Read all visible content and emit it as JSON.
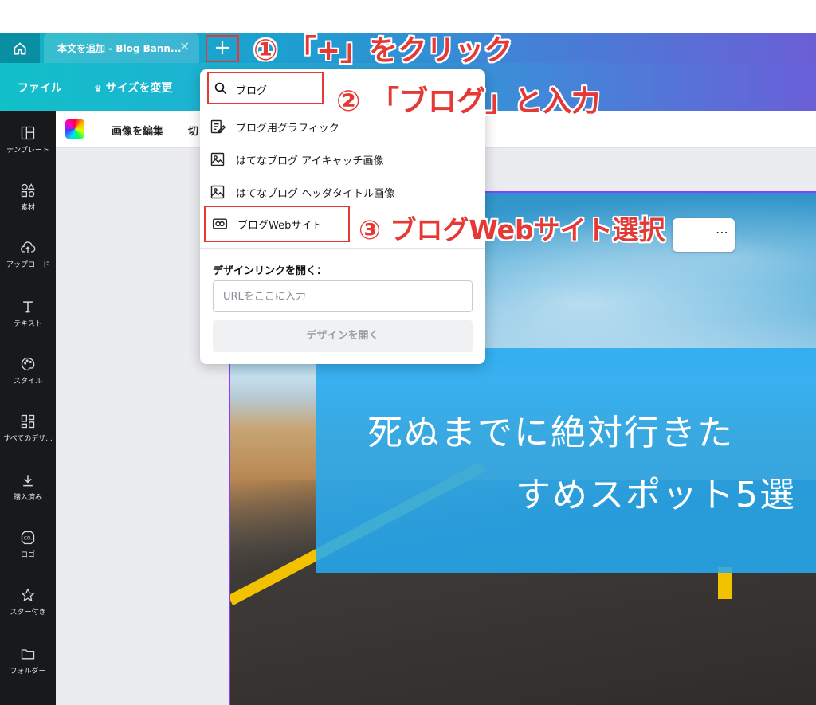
{
  "tabbar": {
    "home_icon": "home-icon",
    "doc_tab_title": "本文を追加 - Blog Bann...",
    "doc_tab_close": "×",
    "new_tab_plus": "+"
  },
  "menubar": {
    "file": "ファイル",
    "resize": "サイズを変更",
    "resize_icon": "crown-icon"
  },
  "sidebar": {
    "items": [
      {
        "label": "テンプレート",
        "icon": "template-icon"
      },
      {
        "label": "素材",
        "icon": "elements-icon"
      },
      {
        "label": "アップロード",
        "icon": "upload-icon"
      },
      {
        "label": "テキスト",
        "icon": "text-icon"
      },
      {
        "label": "スタイル",
        "icon": "palette-icon"
      },
      {
        "label": "すべてのデザ...",
        "icon": "grid-icon"
      },
      {
        "label": "購入済み",
        "icon": "download-icon"
      },
      {
        "label": "ロゴ",
        "icon": "logo-icon"
      },
      {
        "label": "スター付き",
        "icon": "star-icon"
      },
      {
        "label": "フォルダー",
        "icon": "folder-icon"
      }
    ]
  },
  "editbar": {
    "edit_image": "画像を編集",
    "crop_partial": "切"
  },
  "dropdown": {
    "search_value": "ブログ",
    "results": [
      {
        "label": "ブログ用グラフィック",
        "icon": "edit-doc-icon"
      },
      {
        "label": "はてなブログ アイキャッチ画像",
        "icon": "image-icon"
      },
      {
        "label": "はてなブログ ヘッダタイトル画像",
        "icon": "image-icon"
      },
      {
        "label": "ブログWebサイト",
        "icon": "website-icon"
      }
    ],
    "open_link_heading": "デザインリンクを開く：",
    "url_placeholder": "URLをここに入力",
    "open_button": "デザインを開く"
  },
  "design": {
    "line1": "死ぬまでに絶対行きた",
    "line2": "すめスポット5選"
  },
  "annotations": {
    "step1": "① 「+」をクリック",
    "step2": "② 「ブログ」と入力",
    "step3": "③ ブログWebサイト選択"
  },
  "colors": {
    "accent": "#8b3dff",
    "annotation_red": "#e53935",
    "teal": "#11c0c8",
    "sidebar": "#18191b"
  }
}
